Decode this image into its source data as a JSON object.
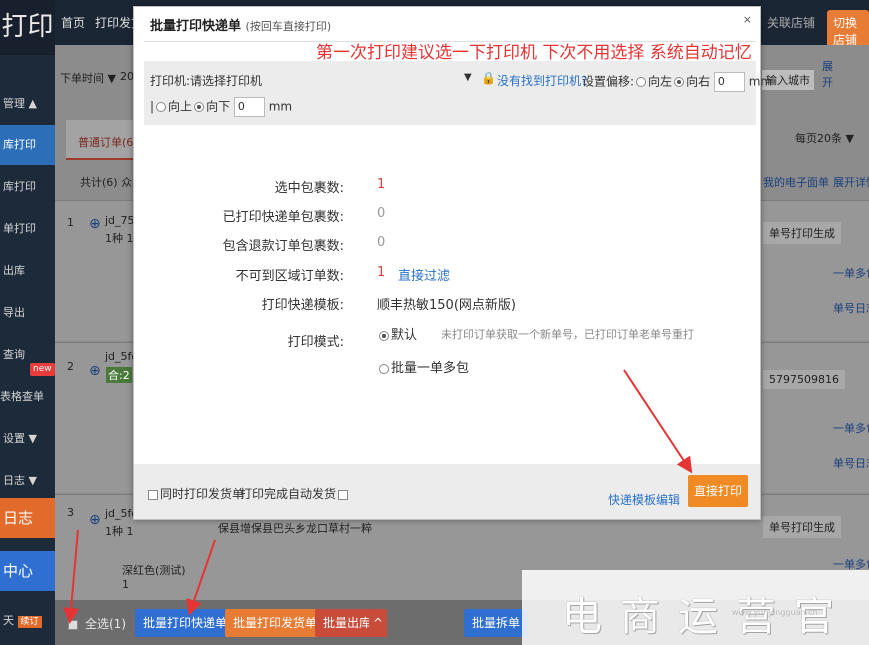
{
  "sidebar": {
    "logo": "打印",
    "items": [
      {
        "label": "管理 ▲"
      },
      {
        "label": "库打印"
      },
      {
        "label": "库打印"
      },
      {
        "label": "单打印"
      },
      {
        "label": "出库"
      },
      {
        "label": "导出"
      },
      {
        "label": "查询"
      },
      {
        "label": "表格查单"
      },
      {
        "label": "设置 ▼"
      },
      {
        "label": "日志 ▼"
      },
      {
        "label": "日志"
      },
      {
        "label": "中心"
      },
      {
        "label": "天"
      }
    ],
    "new_badge": "new",
    "bottom_tag": "续订"
  },
  "topbar": {
    "links": [
      "首页",
      "打印发货"
    ],
    "right_link": "切换店铺",
    "right_btn": "切换店铺",
    "right_text": "关联店铺"
  },
  "background": {
    "filter_label": "下单时间 ▼",
    "filter_value": "20",
    "tab_all": "普通订单(6)",
    "count_text": "共计(6)  众",
    "city_placeholder": "输入城市",
    "expand_text": "展开",
    "per_page": "每页20条 ▼",
    "my_sheet": "我的电子面单",
    "expand_detail": "展开详情",
    "row1": {
      "index": "1",
      "id": "jd_7557",
      "qty": "1种 1",
      "action": "单号打印生成",
      "link1": "一单多包",
      "link2": "单号日志"
    },
    "row2": {
      "index": "2",
      "id": "jd_5fde",
      "tag": "合:2",
      "tracking": "5797509816",
      "link1": "一单多包",
      "link2": "单号日志"
    },
    "row3": {
      "index": "3",
      "id": "jd_5fde",
      "qty": "1种 1",
      "addr": "保县增保县巴头乡龙口草村一粹",
      "action": "单号打印生成",
      "link1": "一单多包"
    },
    "product": "深红色(测试)",
    "product_qty": "1"
  },
  "bottom_bar": {
    "select_all": "全选(1)",
    "btn_batch_print_express": "批量打印快递单",
    "btn_batch_print_ship": "批量打印发货单",
    "btn_batch_outbound": "批量出库",
    "btn_batch_split": "批量拆单"
  },
  "dialog": {
    "title": "批量打印快递单",
    "subtitle": "(按回车直接打印)",
    "close": "×",
    "note": "第一次打印建议选一下打印机 下次不用选择 系统自动记忆",
    "printer": {
      "label": "打印机:请选择打印机",
      "no_printer_link": "没有找到打印机?",
      "offset_label": "设置偏移:",
      "left": "向左",
      "right": "向右",
      "h_value": "0",
      "unit": "mm",
      "up": "向上",
      "down": "向下",
      "v_value": "0"
    },
    "rows": [
      {
        "label": "选中包裹数:",
        "value": "1"
      },
      {
        "label": "已打印快递单包裹数:",
        "value": "0"
      },
      {
        "label": "包含退款订单包裹数:",
        "value": "0"
      },
      {
        "label": "不可到区域订单数:",
        "value": "1",
        "link": "直接过滤"
      },
      {
        "label": "打印快递模板:",
        "value": "顺丰热敏150(网点新版)"
      },
      {
        "label": "打印模式:"
      }
    ],
    "mode_default": "默认",
    "mode_default_desc": "未打印订单获取一个新单号，已打印订单老单号重打",
    "mode_batch": "批量一单多包",
    "footer": {
      "print_ship_too": "同时打印发货单",
      "auto_ship": "打印完成自动发货",
      "template_edit": "快递模板编辑",
      "print_now": "直接打印"
    }
  },
  "watermark": {
    "text": "电商运营官",
    "small": "www.yunyingguan.cn"
  },
  "colors": {
    "accent_orange": "#f08a24",
    "note_red": "#e63434",
    "link_blue": "#2a72c8",
    "sidebar": "#1d2a3a"
  }
}
